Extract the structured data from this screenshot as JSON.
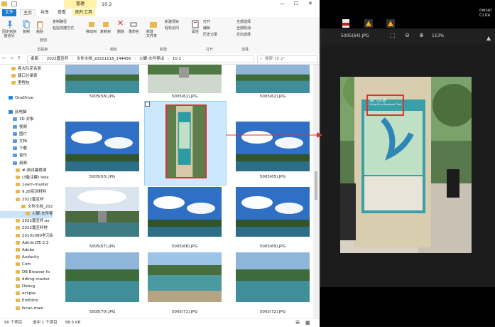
{
  "window": {
    "title": "10.2",
    "tool_tab": "管理",
    "min": "—",
    "max": "☐",
    "close": "✕"
  },
  "ribbon_tabs": [
    "文件",
    "主页",
    "共享",
    "查看",
    "图片工具"
  ],
  "ribbon": {
    "clipboard": {
      "pin": "固定到快\n速访问",
      "copy": "复制",
      "paste": "粘贴",
      "copy_path": "复制路径",
      "paste_shortcut": "粘贴快捷方式",
      "cut": "剪切",
      "label": "剪贴板"
    },
    "organize": {
      "move_to": "移动到",
      "copy_to": "复制到",
      "delete": "删除",
      "rename": "重命名",
      "label": "组织"
    },
    "new": {
      "new_folder": "新建\n文件夹",
      "new_item": "新建项目",
      "easy_access": "轻松访问",
      "label": "新建"
    },
    "open": {
      "properties": "属性",
      "open": "打开",
      "edit": "编辑",
      "history": "历史记录",
      "label": "打开"
    },
    "select": {
      "select_all": "全部选择",
      "select_none": "全部取消",
      "invert": "反向选择",
      "label": "选择"
    }
  },
  "address": {
    "path": [
      "桌面",
      "2022嘉豆杯",
      "文件文档_20221116_144456",
      "火脚-文件导出",
      "10.2"
    ],
    "search_placeholder": "搜索\"10.2\""
  },
  "nav": [
    {
      "label": "各大队花名册",
      "type": "folder"
    },
    {
      "label": "疆口分录表",
      "type": "folder"
    },
    {
      "label": "里程包",
      "type": "folder"
    },
    {
      "label": "",
      "type": "spacer"
    },
    {
      "label": "OneDrive",
      "type": "cloud"
    },
    {
      "label": "",
      "type": "spacer"
    },
    {
      "label": "此电脑",
      "type": "pc"
    },
    {
      "label": "3D 对象",
      "type": "sub"
    },
    {
      "label": "视频",
      "type": "sub"
    },
    {
      "label": "图片",
      "type": "sub"
    },
    {
      "label": "文档",
      "type": "sub"
    },
    {
      "label": "下载",
      "type": "sub"
    },
    {
      "label": "音乐",
      "type": "sub"
    },
    {
      "label": "桌面",
      "type": "sub"
    },
    {
      "label": "#-测试暑假课",
      "type": "folder2"
    },
    {
      "label": "(3备注模) Vola",
      "type": "folder2"
    },
    {
      "label": "1earn-master",
      "type": "folder2"
    },
    {
      "label": "9.28实训材料",
      "type": "folder2"
    },
    {
      "label": "2022嘉豆杯",
      "type": "folder2"
    },
    {
      "label": "文件文档_202",
      "type": "folder3"
    },
    {
      "label": "火脚-文件导",
      "type": "folder4"
    },
    {
      "label": "2022嘉豆杯.as",
      "type": "folder2"
    },
    {
      "label": "2022嘉豆杯材",
      "type": "folder2"
    },
    {
      "label": "20101080学习会",
      "type": "folder2"
    },
    {
      "label": "AdminLTE-2.3",
      "type": "folder2"
    },
    {
      "label": "Adobe",
      "type": "folder2"
    },
    {
      "label": "Audacity",
      "type": "folder2"
    },
    {
      "label": "Com",
      "type": "folder2"
    },
    {
      "label": "DB Browser fo",
      "type": "folder2"
    },
    {
      "label": "ddimg-master",
      "type": "folder2"
    },
    {
      "label": "Debug",
      "type": "folder2"
    },
    {
      "label": "eclipse",
      "type": "folder2"
    },
    {
      "label": "EmEdito",
      "type": "folder2"
    },
    {
      "label": "fscan-main",
      "type": "folder2"
    }
  ],
  "files": [
    {
      "name": "5005(58).JPG",
      "scene": "lake"
    },
    {
      "name": "5005(61).JPG",
      "scene": "trees"
    },
    {
      "name": "5005(62).JPG",
      "scene": "lake"
    },
    {
      "name": "5005(63).JPG",
      "scene": "sky"
    },
    {
      "name": "5005(64).JPG",
      "scene": "sign"
    },
    {
      "name": "5005(65).JPG",
      "scene": "sky"
    },
    {
      "name": "5005(67).JPG",
      "scene": "tower"
    },
    {
      "name": "5005(68).JPG",
      "scene": "sky"
    },
    {
      "name": "5005(69).JPG",
      "scene": "sky"
    },
    {
      "name": "5005(70).JPG",
      "scene": "lake"
    },
    {
      "name": "5005(71).JPG",
      "scene": "shore"
    },
    {
      "name": "5005(72).JPG",
      "scene": "lake"
    }
  ],
  "status": {
    "count": "90 个项目",
    "selected": "选中 1 个项目",
    "size": "88.5 KB"
  },
  "viewer": {
    "filename": "5005(64).JPG",
    "zoom": "113%",
    "sign_title": "城門水塘",
    "sign_subtitle": "Shing Mun Reservoir Trail"
  },
  "desktop_text": [
    "owser",
    "CLite"
  ],
  "colors": {
    "accent": "#1979ca",
    "manage": "#fff1a8",
    "highlight_border": "#e03030"
  }
}
